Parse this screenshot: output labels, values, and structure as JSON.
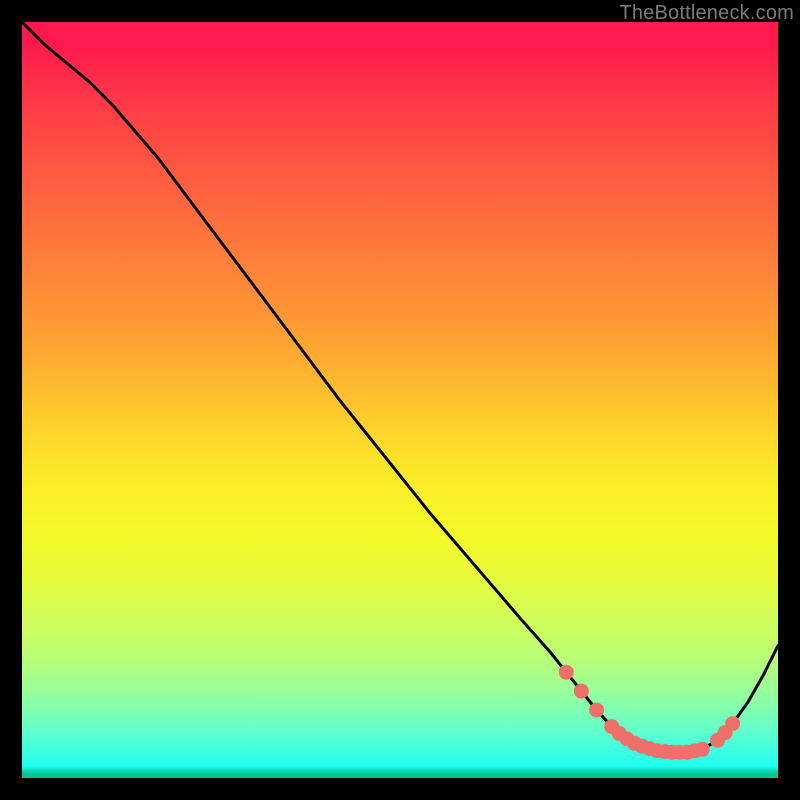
{
  "watermark": "TheBottleneck.com",
  "colors": {
    "curve_stroke": "#000000",
    "marker_fill": "#ef6f6a",
    "marker_stroke": "#ef6f6a"
  },
  "chart_data": {
    "type": "line",
    "title": "",
    "xlabel": "",
    "ylabel": "",
    "xlim": [
      0,
      100
    ],
    "ylim": [
      0,
      100
    ],
    "grid": false,
    "legend": false,
    "description": "Bottleneck-style curve on a vertical red→green gradient. Y is relative 'badness' (100 at top, 0 at bottom). Minimum plateau around x≈78–90.",
    "series": [
      {
        "name": "curve",
        "x": [
          0,
          3,
          6,
          9,
          12,
          18,
          24,
          30,
          36,
          42,
          48,
          54,
          60,
          66,
          70,
          72,
          74,
          76,
          78,
          80,
          82,
          84,
          86,
          88,
          90,
          92,
          94,
          96,
          98,
          100
        ],
        "y": [
          100,
          97,
          94.5,
          92,
          89,
          82,
          74,
          66,
          58,
          50,
          42.5,
          35,
          28,
          21,
          16.5,
          14,
          11.5,
          9,
          6.8,
          5.2,
          4.2,
          3.6,
          3.4,
          3.4,
          3.8,
          5,
          7.2,
          10,
          13.5,
          17.5
        ]
      }
    ],
    "markers": {
      "name": "plateau-dots",
      "x": [
        72,
        74,
        76,
        78,
        79,
        80,
        81,
        82,
        83,
        84,
        85,
        86,
        87,
        88,
        89,
        90,
        92,
        93,
        94
      ],
      "y": [
        14,
        11.5,
        9,
        6.8,
        5.9,
        5.2,
        4.6,
        4.2,
        3.9,
        3.6,
        3.5,
        3.4,
        3.4,
        3.4,
        3.6,
        3.8,
        5,
        6,
        7.2
      ]
    }
  }
}
